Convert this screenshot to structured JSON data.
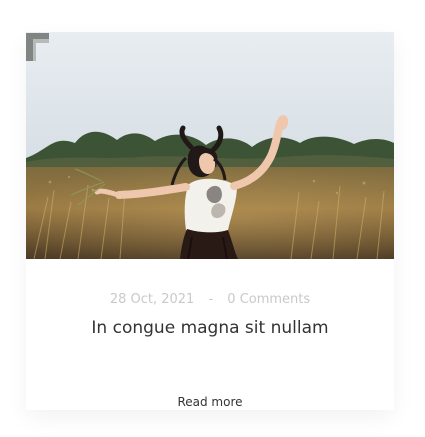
{
  "post": {
    "date": "28 Oct, 2021",
    "separator": "-",
    "comments": "0 Comments",
    "title": "In congue magna sit nullam",
    "read_more": "Read more"
  },
  "image": {
    "alt": "Woman jumping happily in a golden grass field",
    "icon": "corner-mark-icon"
  },
  "colors": {
    "meta": "#c9c9c9",
    "title": "#333333",
    "link": "#333333",
    "card_background": "#ffffff"
  }
}
